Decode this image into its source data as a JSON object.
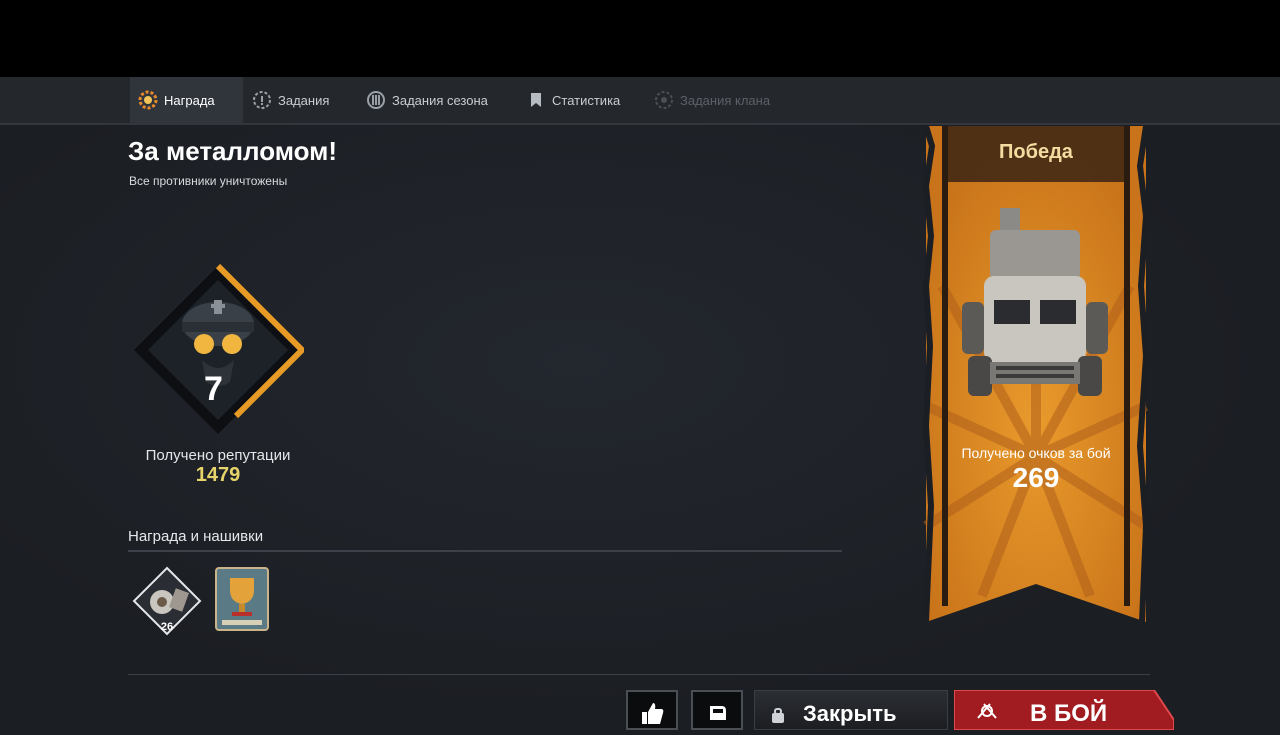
{
  "tabs": [
    {
      "label": "Награда",
      "icon": "reward-gear-icon",
      "active": true
    },
    {
      "label": "Задания",
      "icon": "tasks-gear-icon"
    },
    {
      "label": "Задания сезона",
      "icon": "season-tasks-icon"
    },
    {
      "label": "Статистика",
      "icon": "statistics-icon"
    },
    {
      "label": "Задания клана",
      "icon": "clan-tasks-icon",
      "disabled": true
    }
  ],
  "header": {
    "title": "За металломом!",
    "subtitle": "Все противники уничтожены"
  },
  "reputation": {
    "rank_number": "7",
    "label": "Получено репутации",
    "value": "1479"
  },
  "rewards": {
    "section_title": "Награда и нашивки",
    "items": [
      {
        "icon": "scrap-reward-icon",
        "count": "26"
      },
      {
        "icon": "trophy-patch-icon"
      }
    ]
  },
  "banner": {
    "title": "Победа",
    "score_label": "Получено очков за бой",
    "score_value": "269",
    "vehicle_icon": "armored-car-icon"
  },
  "actions": {
    "like_icon": "thumbs-up-icon",
    "report_icon": "fist-icon",
    "close_label": "Закрыть",
    "fight_label": "В БОЙ"
  },
  "colors": {
    "accent_gold": "#e6d46a",
    "banner_orange": "#d88a1e",
    "fight_red": "#9c1a1e"
  }
}
